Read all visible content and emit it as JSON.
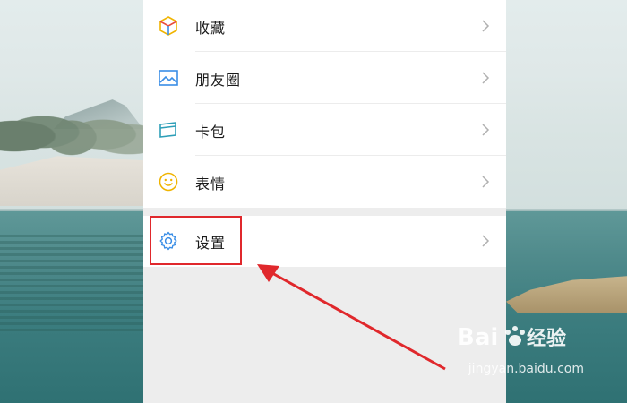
{
  "menu": {
    "items": [
      {
        "label": "收藏",
        "icon": "cube-icon"
      },
      {
        "label": "朋友圈",
        "icon": "image-icon"
      },
      {
        "label": "卡包",
        "icon": "card-icon"
      },
      {
        "label": "表情",
        "icon": "smile-icon"
      }
    ],
    "settings": {
      "label": "设置",
      "icon": "gear-icon"
    }
  },
  "watermark": {
    "logo_lettering": "Baidu 经验",
    "url": "jingyan.baidu.com"
  },
  "colors": {
    "highlight": "#e0282c",
    "arrow": "#e0282c",
    "panel_bg": "#ededed",
    "card_bg": "#ffffff"
  }
}
